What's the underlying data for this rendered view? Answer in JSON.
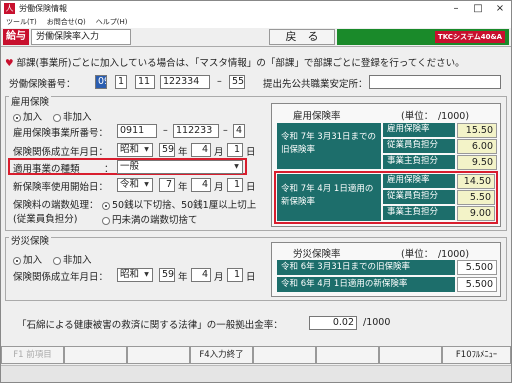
{
  "window": {
    "title": "労働保険情報",
    "badge_icon": "人"
  },
  "menu": [
    "ツール(T)",
    "お問合せ(Q)",
    "ヘルプ(H)"
  ],
  "toolbar": {
    "badge": "給与",
    "tool_name": "労働保険率入力",
    "back": "戻　る",
    "brand": "TKCシステム40&A"
  },
  "notice": "部課(事業所)ごとに加入している場合は、「マスタ情報」の「部課」で部課ごとに登録を行ってください。",
  "insurance_no": {
    "label": "労働保険番号：",
    "f1": "09",
    "f2": "1",
    "f3": "11",
    "f4": "122334",
    "dash": "–",
    "f5": "55"
  },
  "submit_office": {
    "label": "提出先公共職業安定所：",
    "value": ""
  },
  "employment": {
    "group": "雇用保険",
    "join": "加入",
    "nojoin": "非加入",
    "office_no_label": "雇用保険事業所番号：",
    "o1": "0911",
    "o2": "112233",
    "o3": "4",
    "est_label": "保険関係成立年月日：",
    "era": "昭和",
    "year": "59",
    "y_unit": "年",
    "month": "4",
    "m_unit": "月",
    "day": "1",
    "d_unit": "日",
    "biz_type_label": "適用事業の種類",
    "colon": "：",
    "biz_type": "一般",
    "start_label": "新保険率使用開始日：",
    "s_era": "令和",
    "s_year": "7",
    "s_month": "4",
    "s_day": "1",
    "rounding_label": "保険料の端数処理：",
    "rounding_sub": "(従業員負担分)",
    "round_opt1": "50銭以下切捨、50銭1厘以上切上",
    "round_opt2": "円未満の端数切捨て"
  },
  "emp_rate": {
    "title": "雇用保険率",
    "unit": "(単位：　/1000)",
    "old_label": "令和 7年 3月31日までの旧保険率",
    "new_label": "令和 7年 4月 1日適用の新保険率",
    "r1": "雇用保険率",
    "r2": "従業員負担分",
    "r3": "事業主負担分",
    "old_values": [
      "15.50",
      "6.00",
      "9.50"
    ],
    "new_values": [
      "14.50",
      "5.50",
      "9.00"
    ]
  },
  "workers": {
    "group": "労災保険",
    "join": "加入",
    "nojoin": "非加入",
    "est_label": "保険関係成立年月日：",
    "era": "昭和",
    "year": "59",
    "y_unit": "年",
    "month": "4",
    "m_unit": "月",
    "day": "1",
    "d_unit": "日"
  },
  "work_rate": {
    "title": "労災保険率",
    "unit": "(単位：　/1000)",
    "old_label": "令和 6年 3月31日までの旧保険率",
    "new_label": "令和 6年 4月 1日適用の新保険率",
    "old_value": "5.500",
    "new_value": "5.500"
  },
  "asbestos": {
    "label": "「石綿による健康被害の救済に関する法律」の一般拠出金率：",
    "value": "0.02",
    "unit": "/1000"
  },
  "fkeys": {
    "f1": "F1 前項目",
    "f4": "F4入力終了",
    "f10": "F10ﾌﾙﾒﾆｭｰ"
  }
}
